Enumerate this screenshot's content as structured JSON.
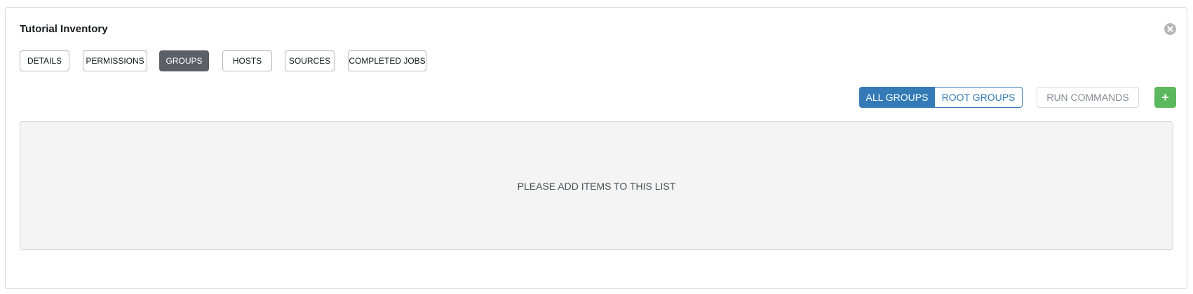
{
  "panel": {
    "title": "Tutorial Inventory"
  },
  "tabs": [
    {
      "label": "DETAILS",
      "active": false
    },
    {
      "label": "PERMISSIONS",
      "active": false
    },
    {
      "label": "GROUPS",
      "active": true
    },
    {
      "label": "HOSTS",
      "active": false
    },
    {
      "label": "SOURCES",
      "active": false
    },
    {
      "label": "COMPLETED JOBS",
      "active": false
    }
  ],
  "toolbar": {
    "all_groups_label": "ALL GROUPS",
    "root_groups_label": "ROOT GROUPS",
    "selected_filter": "ALL GROUPS",
    "run_commands_label": "RUN COMMANDS",
    "add_label": "+"
  },
  "list": {
    "empty_message": "PLEASE ADD ITEMS TO THIS LIST"
  },
  "colors": {
    "active_tab": "#5c5f66",
    "primary": "#337ab7",
    "add_button": "#5cb85c",
    "empty_list_bg": "#f4f4f4"
  },
  "icons": {
    "close": "close-circle-icon"
  }
}
